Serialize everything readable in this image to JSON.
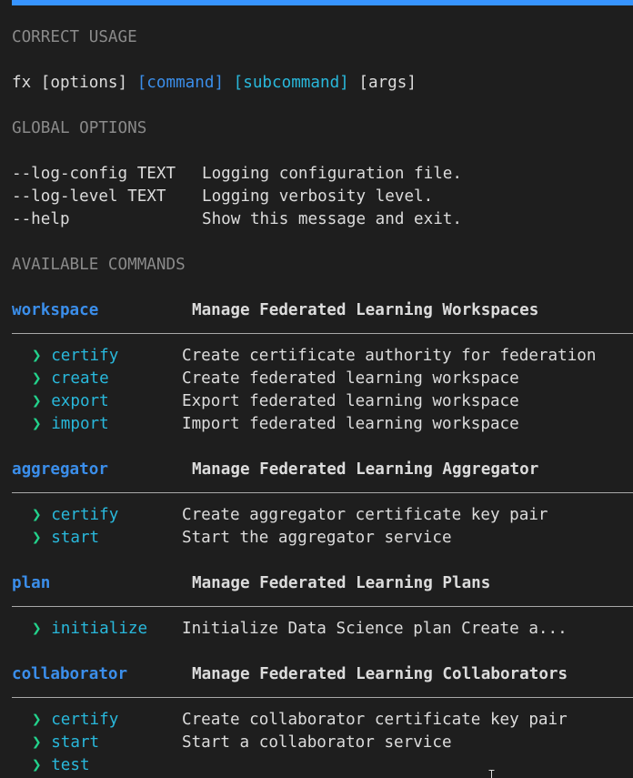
{
  "sections": {
    "usage_header": "CORRECT USAGE",
    "usage": {
      "prog": "fx",
      "options": "[options]",
      "command": "[command]",
      "subcommand": "[subcommand]",
      "args": "[args]"
    },
    "global_header": "GLOBAL OPTIONS",
    "global_options": [
      {
        "flag": "--log-config TEXT",
        "desc": "Logging configuration file."
      },
      {
        "flag": "--log-level TEXT",
        "desc": "Logging verbosity level."
      },
      {
        "flag": "--help",
        "desc": "Show this message and exit."
      }
    ],
    "commands_header": "AVAILABLE COMMANDS"
  },
  "commands": [
    {
      "name": "workspace",
      "desc": "Manage Federated Learning Workspaces",
      "subcommands": [
        {
          "name": "certify",
          "desc": "Create certificate authority for federation"
        },
        {
          "name": "create",
          "desc": "Create federated learning workspace"
        },
        {
          "name": "export",
          "desc": "Export federated learning workspace"
        },
        {
          "name": "import",
          "desc": "Import federated learning workspace"
        }
      ]
    },
    {
      "name": "aggregator",
      "desc": "Manage Federated Learning Aggregator",
      "subcommands": [
        {
          "name": "certify",
          "desc": "Create aggregator certificate key pair"
        },
        {
          "name": "start",
          "desc": "Start the aggregator service"
        }
      ]
    },
    {
      "name": "plan",
      "desc": "Manage Federated Learning Plans",
      "subcommands": [
        {
          "name": "initialize",
          "desc": "Initialize Data Science plan Create a..."
        }
      ]
    },
    {
      "name": "collaborator",
      "desc": "Manage Federated Learning Collaborators",
      "subcommands": [
        {
          "name": "certify",
          "desc": "Create collaborator certificate key pair"
        },
        {
          "name": "start",
          "desc": "Start a collaborator service"
        },
        {
          "name": "test",
          "desc": ""
        }
      ]
    }
  ],
  "icons": {
    "subcommand_marker": "chevron-right-icon"
  },
  "colors": {
    "background": "#1e1e1e",
    "accent_bar": "#3794ff",
    "command": "#3b8eea",
    "subcommand": "#29b8db",
    "chevron": "#23d18b",
    "dim": "#8a8a8a"
  }
}
